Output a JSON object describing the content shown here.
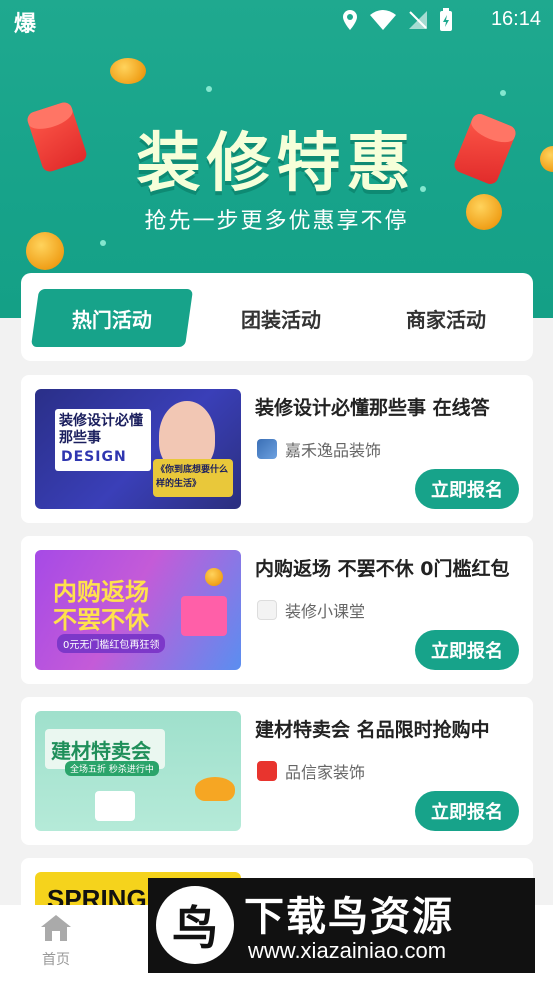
{
  "status_bar": {
    "app_glyph": "爆",
    "time": "16:14"
  },
  "hero": {
    "title": "装修特惠",
    "subtitle": "抢先一步更多优惠享不停"
  },
  "tabs": [
    {
      "label": "热门活动",
      "active": true
    },
    {
      "label": "团装活动",
      "active": false
    },
    {
      "label": "商家活动",
      "active": false
    }
  ],
  "activities": [
    {
      "title": "装修设计必懂那些事 在线答",
      "shop": "嘉禾逸品装饰",
      "button": "立即报名",
      "thumb_main": "装修设计必懂那些事",
      "thumb_sub": "DESIGN",
      "thumb_quote": "《你到底想要什么样的生活》"
    },
    {
      "title": "内购返场 不罢不休 0门槛红包",
      "shop": "装修小课堂",
      "button": "立即报名",
      "thumb_main": "内购返场",
      "thumb_main2": "不罢不休",
      "thumb_tag": "0元无门槛红包再狂领"
    },
    {
      "title": "建材特卖会 名品限时抢购中",
      "shop": "品信家装饰",
      "button": "立即报名",
      "thumb_main": "建材特卖会",
      "thumb_tag": "全场五折 秒杀进行中"
    },
    {
      "thumb_main": "SPRING"
    }
  ],
  "bottom_nav": {
    "home_label": "首页"
  },
  "watermark": {
    "logo_char": "鸟",
    "title": "下载鸟资源",
    "url": "www.xiazainiao.com"
  },
  "colors": {
    "primary": "#17a38a",
    "hero_title": "#f6ffd9"
  }
}
